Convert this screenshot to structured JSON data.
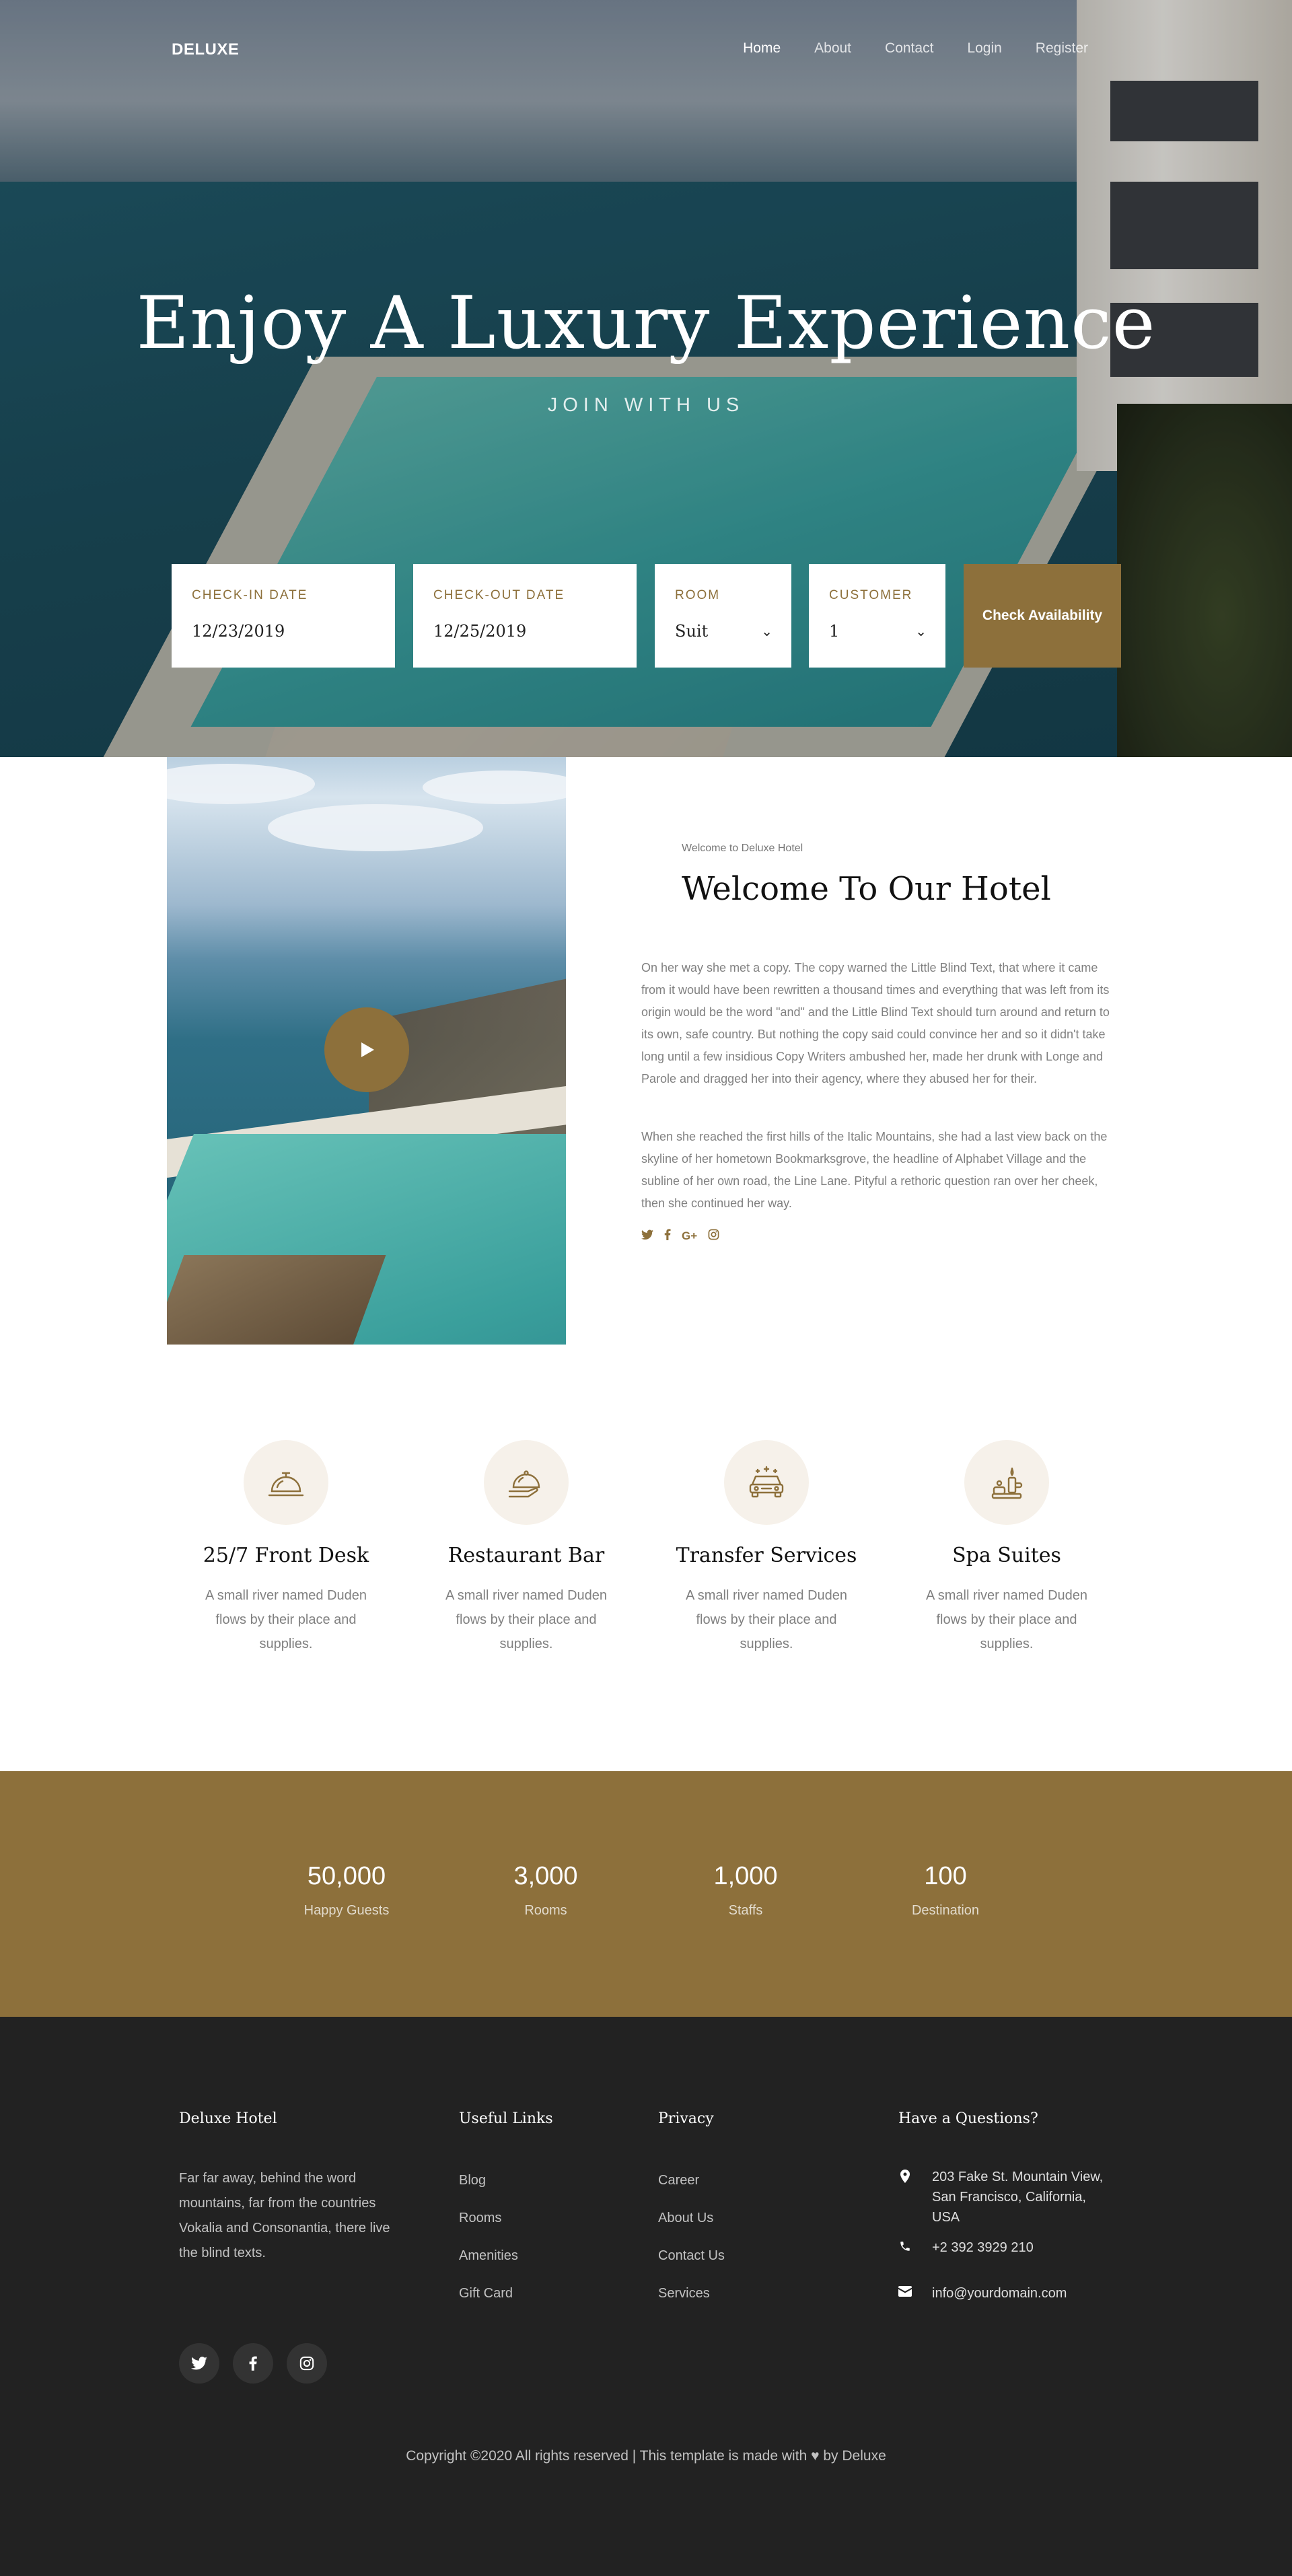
{
  "nav": {
    "brand": "DELUXE",
    "links": [
      "Home",
      "About",
      "Contact",
      "Login",
      "Register"
    ],
    "active": "Home"
  },
  "hero": {
    "title": "Enjoy A Luxury Experience",
    "subtitle": "JOIN WITH US"
  },
  "booking": {
    "checkin_label": "CHECK-IN DATE",
    "checkin_value": "12/23/2019",
    "checkout_label": "CHECK-OUT DATE",
    "checkout_value": "12/25/2019",
    "room_label": "ROOM",
    "room_value": "Suit",
    "customer_label": "CUSTOMER",
    "customer_value": "1",
    "button": "Check Availability"
  },
  "welcome": {
    "kicker": "Welcome to Deluxe Hotel",
    "title": "Welcome To Our Hotel",
    "paragraph1": "On her way she met a copy. The copy warned the Little Blind Text, that where it came from it would have been rewritten a thousand times and everything that was left from its origin would be the word \"and\" and the Little Blind Text should turn around and return to its own, safe country. But nothing the copy said could convince her and so it didn't take long until a few insidious Copy Writers ambushed her, made her drunk with Longe and Parole and dragged her into their agency, where they abused her for their.",
    "paragraph2": "When she reached the first hills of the Italic Mountains, she had a last view back on the skyline of her hometown Bookmarksgrove, the headline of Alphabet Village and the subline of her own road, the Line Lane. Pityful a rethoric question ran over her cheek, then she continued her way.",
    "social_icons": [
      "twitter-icon",
      "facebook-icon",
      "google-plus-icon",
      "instagram-icon"
    ]
  },
  "services": [
    {
      "title": "25/7 Front Desk",
      "text": "A small river named Duden flows by their place and supplies.",
      "icon": "reception-bell-icon"
    },
    {
      "title": "Restaurant Bar",
      "text": "A small river named Duden flows by their place and supplies.",
      "icon": "serving-dish-icon"
    },
    {
      "title": "Transfer Services",
      "text": "A small river named Duden flows by their place and supplies.",
      "icon": "car-icon"
    },
    {
      "title": "Spa Suites",
      "text": "A small river named Duden flows by their place and supplies.",
      "icon": "spa-icon"
    }
  ],
  "stats": [
    {
      "value": "50,000",
      "label": "Happy Guests"
    },
    {
      "value": "3,000",
      "label": "Rooms"
    },
    {
      "value": "1,000",
      "label": "Staffs"
    },
    {
      "value": "100",
      "label": "Destination"
    }
  ],
  "footer": {
    "about_heading": "Deluxe Hotel",
    "about_text": "Far far away, behind the word mountains, far from the countries Vokalia and Consonantia, there live the blind texts.",
    "links_heading": "Useful Links",
    "links": [
      "Blog",
      "Rooms",
      "Amenities",
      "Gift Card"
    ],
    "privacy_heading": "Privacy",
    "privacy_links": [
      "Career",
      "About Us",
      "Contact Us",
      "Services"
    ],
    "contact_heading": "Have a Questions?",
    "address": "203 Fake St. Mountain View, San Francisco, California, USA",
    "phone": "+2 392 3929 210",
    "email": "info@yourdomain.com",
    "copyright_pre": "Copyright ©2020 All rights reserved | This template is made with",
    "copyright_post": "by Deluxe"
  },
  "colors": {
    "accent": "#8d703b",
    "footer_bg": "#222222",
    "service_circle": "#f6f1ea"
  }
}
